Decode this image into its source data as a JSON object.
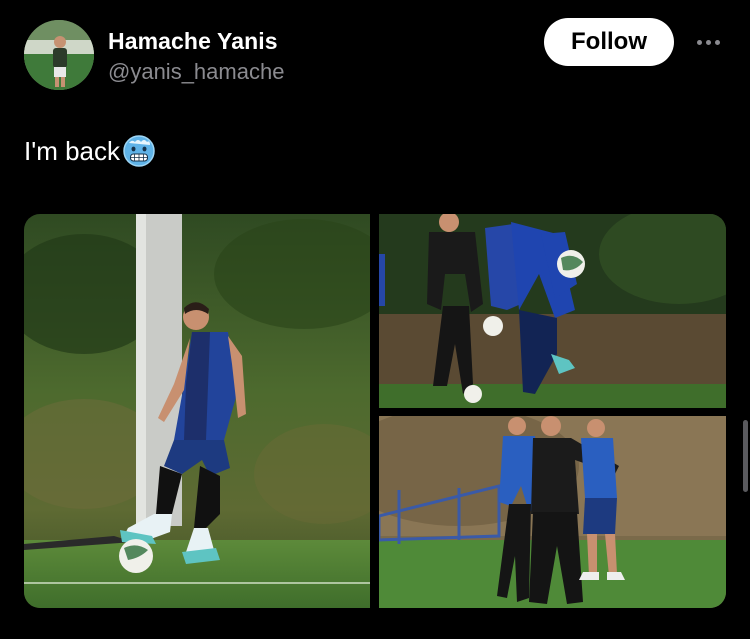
{
  "author": {
    "display_name": "Hamache Yanis",
    "handle": "@yanis_hamache",
    "avatar_icon": "profile-photo-footballer"
  },
  "actions": {
    "follow_label": "Follow",
    "more_icon": "more-horizontal-icon"
  },
  "post": {
    "text": "I'm back",
    "emoji_icon": "cold-face-emoji"
  },
  "media": {
    "photo_count": 3,
    "photos": [
      {
        "subject": "player-dribbling-ball"
      },
      {
        "subject": "players-training-juggling"
      },
      {
        "subject": "coach-and-players-on-pitch"
      }
    ]
  },
  "colors": {
    "background": "#000000",
    "text_primary": "#ffffff",
    "text_secondary": "#8b8b90",
    "follow_button_bg": "#ffffff",
    "follow_button_text": "#000000"
  }
}
